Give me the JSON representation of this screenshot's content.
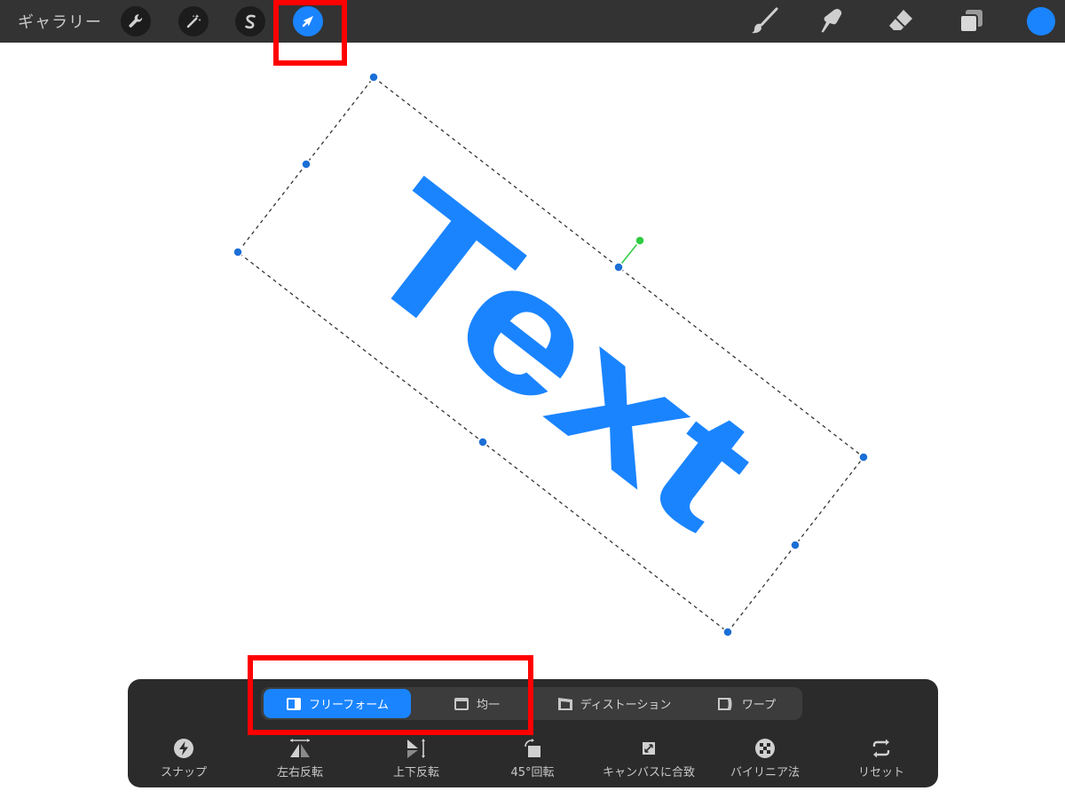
{
  "topbar": {
    "gallery_label": "ギャラリー",
    "tools": [
      {
        "name": "wrench-icon",
        "active": false
      },
      {
        "name": "magic-wand-icon",
        "active": false
      },
      {
        "name": "selection-s-icon",
        "active": false
      },
      {
        "name": "transform-arrow-icon",
        "active": true
      }
    ],
    "right_tools": [
      "brush-icon",
      "smudge-icon",
      "eraser-icon",
      "layers-icon"
    ],
    "color_swatch": "#1a84ff"
  },
  "canvas": {
    "text": "Text",
    "text_color": "#1a84ff",
    "handle_color": "#1c6fd6",
    "rotation_handle_color": "#2ecc40"
  },
  "panel": {
    "modes": [
      {
        "label": "フリーフォーム",
        "active": true
      },
      {
        "label": "均一",
        "active": false
      },
      {
        "label": "ディストーション",
        "active": false
      },
      {
        "label": "ワープ",
        "active": false
      }
    ],
    "actions": [
      {
        "label": "スナップ",
        "icon": "lightning-icon"
      },
      {
        "label": "左右反転",
        "icon": "flip-horizontal-icon"
      },
      {
        "label": "上下反転",
        "icon": "flip-vertical-icon"
      },
      {
        "label": "45°回転",
        "icon": "rotate-45-icon"
      },
      {
        "label": "キャンバスに合致",
        "icon": "fit-canvas-icon"
      },
      {
        "label": "バイリニア法",
        "icon": "bilinear-icon"
      },
      {
        "label": "リセット",
        "icon": "reset-icon"
      }
    ]
  },
  "highlight_color": "#ff0000"
}
